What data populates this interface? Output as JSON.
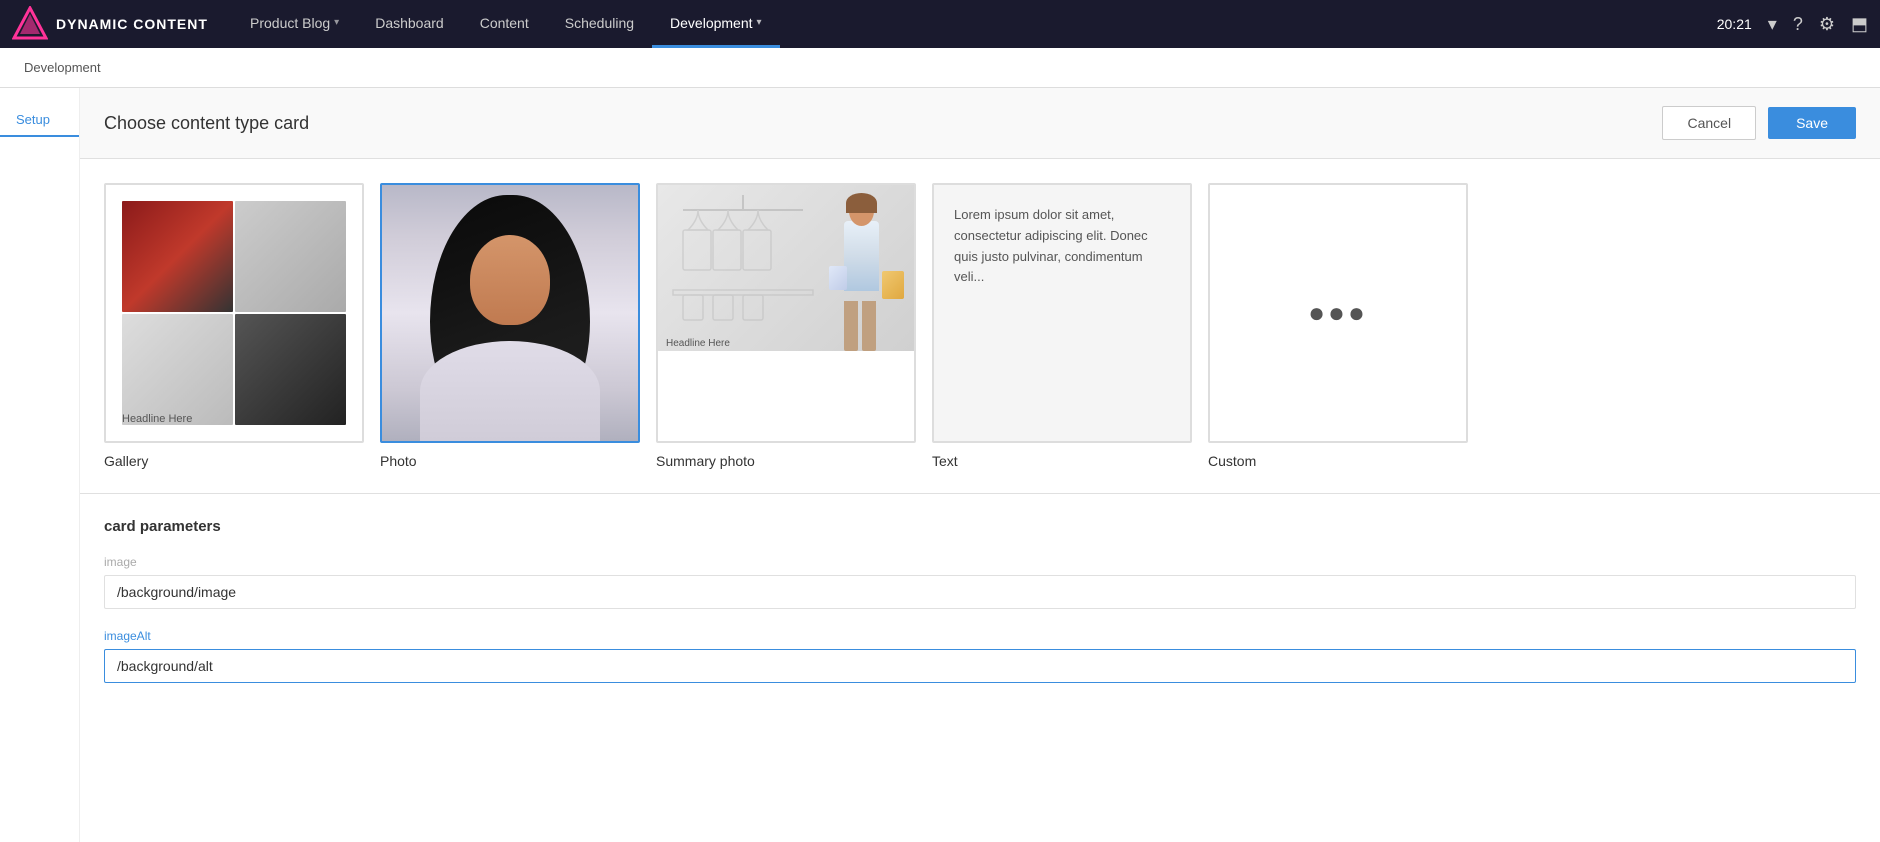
{
  "topnav": {
    "app_name": "DYNAMIC CONTENT",
    "project_name": "Product Blog",
    "nav_items": [
      {
        "label": "Product Blog",
        "caret": true,
        "active": false
      },
      {
        "label": "Dashboard",
        "caret": false,
        "active": false
      },
      {
        "label": "Content",
        "caret": false,
        "active": false
      },
      {
        "label": "Scheduling",
        "caret": false,
        "active": false
      },
      {
        "label": "Development",
        "caret": true,
        "active": true
      }
    ],
    "time": "20:21",
    "caret_char": "▾"
  },
  "secondary_nav": {
    "breadcrumb": "Development"
  },
  "sidebar": {
    "tab_label": "Setup"
  },
  "modal": {
    "title": "Choose content type card",
    "cancel_label": "Cancel",
    "save_label": "Save"
  },
  "card_types": [
    {
      "id": "gallery",
      "label": "Gallery",
      "selected": false
    },
    {
      "id": "photo",
      "label": "Photo",
      "selected": true
    },
    {
      "id": "summary_photo",
      "label": "Summary photo",
      "selected": false
    },
    {
      "id": "text",
      "label": "Text",
      "selected": false
    },
    {
      "id": "custom",
      "label": "Custom",
      "selected": false
    }
  ],
  "text_card_content": "Lorem ipsum dolor sit amet, consectetur adipiscing elit. Donec quis justo pulvinar, condimentum veli...",
  "params": {
    "section_title": "card parameters",
    "fields": [
      {
        "id": "image",
        "label": "image",
        "value": "/background/image",
        "active": false
      },
      {
        "id": "imageAlt",
        "label": "imageAlt",
        "value": "/background/alt",
        "active": true
      }
    ]
  }
}
